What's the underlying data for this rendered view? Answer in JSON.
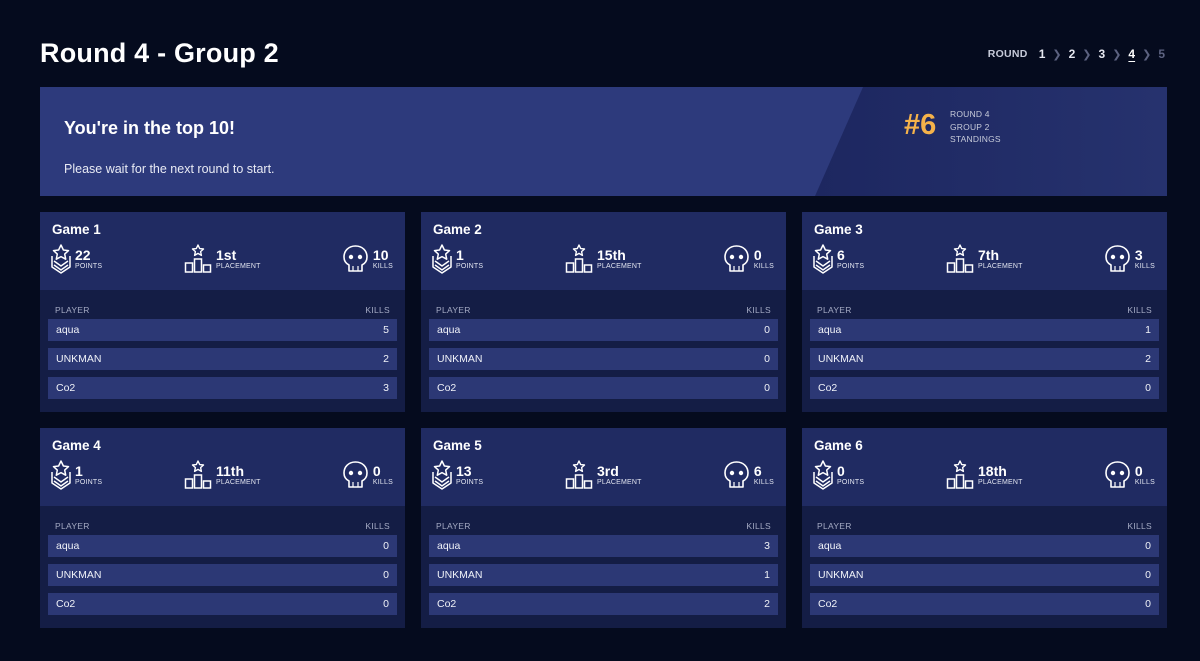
{
  "page": {
    "title": "Round 4 - Group 2"
  },
  "round_nav": {
    "label": "ROUND",
    "rounds": [
      {
        "label": "1",
        "state": "normal"
      },
      {
        "label": "2",
        "state": "normal"
      },
      {
        "label": "3",
        "state": "normal"
      },
      {
        "label": "4",
        "state": "active"
      },
      {
        "label": "5",
        "state": "disabled"
      }
    ]
  },
  "banner": {
    "headline": "You're in the top 10!",
    "subtext": "Please wait for the next round to start.",
    "rank": "#6",
    "rank_lines": [
      "ROUND 4",
      "GROUP 2",
      "STANDINGS"
    ],
    "rank_color": "#f5b24a"
  },
  "labels": {
    "points": "POINTS",
    "placement": "PLACEMENT",
    "kills": "KILLS",
    "col_player": "PLAYER",
    "col_kills": "KILLS"
  },
  "games": [
    {
      "title": "Game 1",
      "points": "22",
      "placement": "1st",
      "kills": "10",
      "players": [
        {
          "name": "aqua",
          "kills": "5"
        },
        {
          "name": "UNKMAN",
          "kills": "2"
        },
        {
          "name": "Co2",
          "kills": "3"
        }
      ]
    },
    {
      "title": "Game 2",
      "points": "1",
      "placement": "15th",
      "kills": "0",
      "players": [
        {
          "name": "aqua",
          "kills": "0"
        },
        {
          "name": "UNKMAN",
          "kills": "0"
        },
        {
          "name": "Co2",
          "kills": "0"
        }
      ]
    },
    {
      "title": "Game 3",
      "points": "6",
      "placement": "7th",
      "kills": "3",
      "players": [
        {
          "name": "aqua",
          "kills": "1"
        },
        {
          "name": "UNKMAN",
          "kills": "2"
        },
        {
          "name": "Co2",
          "kills": "0"
        }
      ]
    },
    {
      "title": "Game 4",
      "points": "1",
      "placement": "11th",
      "kills": "0",
      "players": [
        {
          "name": "aqua",
          "kills": "0"
        },
        {
          "name": "UNKMAN",
          "kills": "0"
        },
        {
          "name": "Co2",
          "kills": "0"
        }
      ]
    },
    {
      "title": "Game 5",
      "points": "13",
      "placement": "3rd",
      "kills": "6",
      "players": [
        {
          "name": "aqua",
          "kills": "3"
        },
        {
          "name": "UNKMAN",
          "kills": "1"
        },
        {
          "name": "Co2",
          "kills": "2"
        }
      ]
    },
    {
      "title": "Game 6",
      "points": "0",
      "placement": "18th",
      "kills": "0",
      "players": [
        {
          "name": "aqua",
          "kills": "0"
        },
        {
          "name": "UNKMAN",
          "kills": "0"
        },
        {
          "name": "Co2",
          "kills": "0"
        }
      ]
    }
  ],
  "icons": {
    "points": "medal-star-icon",
    "placement": "podium-star-icon",
    "kills": "skull-icon"
  }
}
